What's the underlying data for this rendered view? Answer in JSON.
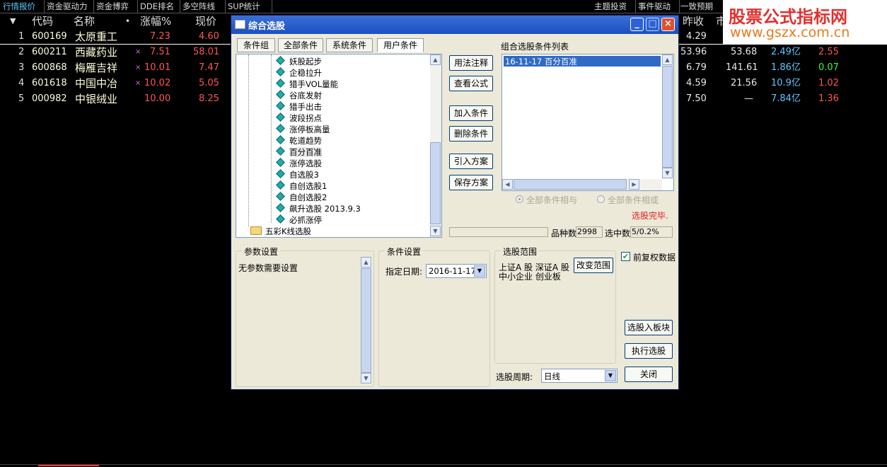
{
  "top_tabs": [
    "行情报价",
    "资金驱动力",
    "资金博弈",
    "DDE排名",
    "多空阵线",
    "SUP统计"
  ],
  "top_tabs_right": [
    "主题投资",
    "事件驱动",
    "一致预期"
  ],
  "table": {
    "headers": {
      "code": "代码",
      "name": "名称",
      "dot": "•",
      "change": "涨幅%",
      "price": "现价",
      "prevclose": "昨收",
      "mkt": "市"
    },
    "rows": [
      {
        "idx": "1",
        "code": "600169",
        "name": "太原重工",
        "mark": "",
        "change": "7.23",
        "price": "4.60",
        "prevclose": "4.29",
        "c1": "",
        "c2": "",
        "c3": ""
      },
      {
        "idx": "2",
        "code": "600211",
        "name": "西藏药业",
        "mark": "×",
        "change": "7.51",
        "price": "58.01",
        "prevclose": "53.96",
        "c1": "53.68",
        "c2": "2.49亿",
        "c3": "2.55"
      },
      {
        "idx": "3",
        "code": "600868",
        "name": "梅雁吉祥",
        "mark": "×",
        "change": "10.01",
        "price": "7.47",
        "prevclose": "6.79",
        "c1": "141.61",
        "c2": "1.86亿",
        "c3": "0.07"
      },
      {
        "idx": "4",
        "code": "601618",
        "name": "中国中冶",
        "mark": "×",
        "change": "10.02",
        "price": "5.05",
        "prevclose": "4.59",
        "c1": "21.56",
        "c2": "10.9亿",
        "c3": "1.02"
      },
      {
        "idx": "5",
        "code": "000982",
        "name": "中银绒业",
        "mark": "",
        "change": "10.00",
        "price": "8.25",
        "prevclose": "7.50",
        "c1": "—",
        "c2": "7.84亿",
        "c3": "1.36"
      }
    ]
  },
  "watermark": {
    "line1": "股票公式指标网",
    "line2": "www.gszx.com.cn"
  },
  "dialog": {
    "title": "综合选股",
    "tabs": [
      "条件组",
      "全部条件",
      "系统条件",
      "用户条件"
    ],
    "tree_items": [
      "妖股起步",
      "企稳拉升",
      "猎手VOL量能",
      "谷底发射",
      "猎手出击",
      "波段拐点",
      "涨停板高量",
      "乾道趋势",
      "百分百准",
      "涨停选股",
      "自选股3",
      "自创选股1",
      "自创选股2",
      "飙升选股 2013.9.3",
      "必抓涨停"
    ],
    "tree_folder": "五彩K线选股",
    "mid_buttons": [
      "用法注释",
      "查看公式",
      "加入条件",
      "删除条件",
      "引入方案",
      "保存方案"
    ],
    "combo_list_label": "组合选股条件列表",
    "combo_list_items": [
      "16-11-17 百分百准"
    ],
    "radio_and": "全部条件相与",
    "radio_or": "全部条件相或",
    "status": "选股完毕.",
    "count_label": "品种数",
    "count_value": "2998",
    "selected_label": "选中数",
    "selected_value": "5/0.2%",
    "param_group": "参数设置",
    "param_text": "无参数需要设置",
    "cond_group": "条件设置",
    "date_label": "指定日期:",
    "date_value": "2016-11-17",
    "range_group": "选股范围",
    "range_line1": "上证A 股  深证A 股",
    "range_line2": "中小企业  创业板",
    "change_range": "改变范围",
    "checkbox_label": "前复权数据",
    "btn_to_block": "选股入板块",
    "btn_exec": "执行选股",
    "btn_close": "关闭",
    "period_label": "选股周期:",
    "period_value": "日线"
  }
}
